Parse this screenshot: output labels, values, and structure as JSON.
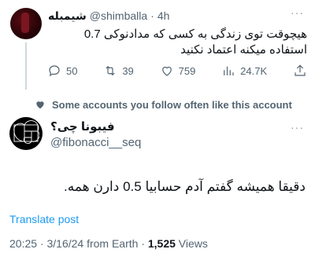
{
  "parent_tweet": {
    "display_name": "شیمبله",
    "handle": "@shimballa",
    "separator": "·",
    "time": "4h",
    "more_label": "···",
    "text": "هیچوقت توی زندگی به کسی که مدادنوکی 0.7 استفاده میکنه اعتماد نکنید",
    "actions": {
      "replies": "50",
      "retweets": "39",
      "likes": "759",
      "views": "24.7K"
    }
  },
  "social_context": {
    "text": "Some accounts you follow often like this account"
  },
  "main_tweet": {
    "display_name": "فیبونا چی؟",
    "handle": "@fibonacci__seq",
    "more_label": "···",
    "text": "دقیقا همیشه گفتم آدم حسابیا 0.5 دارن همه.",
    "translate_label": "Translate post",
    "meta": {
      "posted": "20:25 · 3/16/24 from Earth · ",
      "views_count": "1,525",
      "views_label": " Views"
    }
  },
  "colors": {
    "accent": "#1d9bf0",
    "text_primary": "#0f1419",
    "text_secondary": "#536471"
  },
  "icons": [
    "reply-icon",
    "retweet-icon",
    "like-icon",
    "views-icon",
    "share-icon",
    "heart-icon",
    "more-icon"
  ]
}
